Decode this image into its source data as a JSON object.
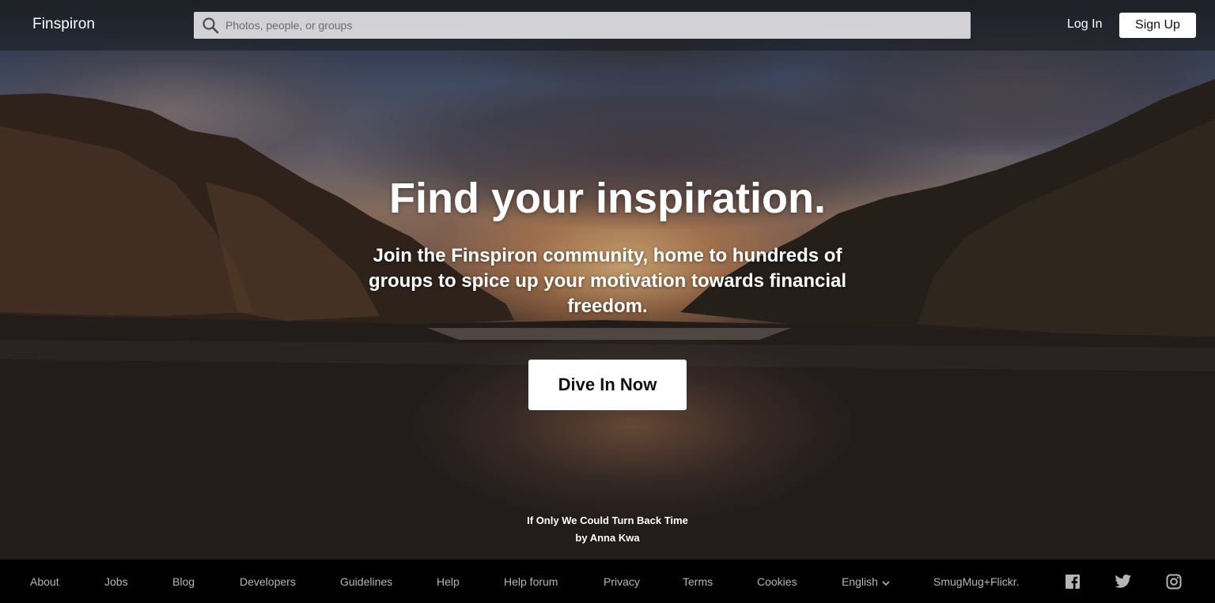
{
  "brand": {
    "name": "Finspiron"
  },
  "search": {
    "placeholder": "Photos, people, or groups",
    "icon": "search-icon"
  },
  "nav": {
    "login_label": "Log In",
    "signup_label": "Sign Up"
  },
  "hero": {
    "headline": "Find your inspiration.",
    "subtitle": "Join the Finspiron community, home to hundreds of groups to spice up your motivation towards financial freedom.",
    "cta_label": "Dive In Now",
    "photo_title": "If Only We Could Turn Back Time",
    "photo_author": "by Anna Kwa"
  },
  "footer": {
    "links": {
      "about": "About",
      "jobs": "Jobs",
      "blog": "Blog",
      "developers": "Developers",
      "guidelines": "Guidelines",
      "help": "Help",
      "help_forum": "Help forum",
      "privacy": "Privacy",
      "terms": "Terms",
      "cookies": "Cookies",
      "smugmug": "SmugMug+Flickr."
    },
    "language": "English",
    "social_icons": [
      "facebook-icon",
      "twitter-icon",
      "instagram-icon"
    ]
  },
  "colors": {
    "footer_bg": "#000000",
    "footer_text": "#b6b6b8",
    "button_bg": "#ffffff",
    "button_text": "#111111"
  }
}
